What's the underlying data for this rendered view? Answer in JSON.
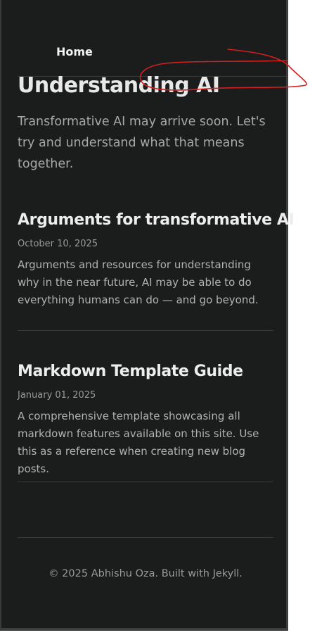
{
  "nav": {
    "home_label": "Home"
  },
  "hero": {
    "title": "Understanding AI",
    "subtitle": "Transformative AI may arrive soon. Let's try and understand what that means together."
  },
  "posts": [
    {
      "title": "Arguments for transformative AI",
      "date": "October 10, 2025",
      "excerpt": "Arguments and resources for understanding why in the near future, AI may be able to do everything humans can do — and go beyond."
    },
    {
      "title": "Markdown Template Guide",
      "date": "January 01, 2025",
      "excerpt": "A comprehensive template showcasing all markdown features available on this site. Use this as a reference when creating new blog posts."
    }
  ],
  "footer": {
    "text": "© 2025 Abhishu Oza. Built with Jekyll."
  },
  "colors": {
    "background": "#1b1c1c",
    "annotation": "#d42020",
    "text_primary": "#ededed",
    "text_muted": "#9a9a9a"
  }
}
